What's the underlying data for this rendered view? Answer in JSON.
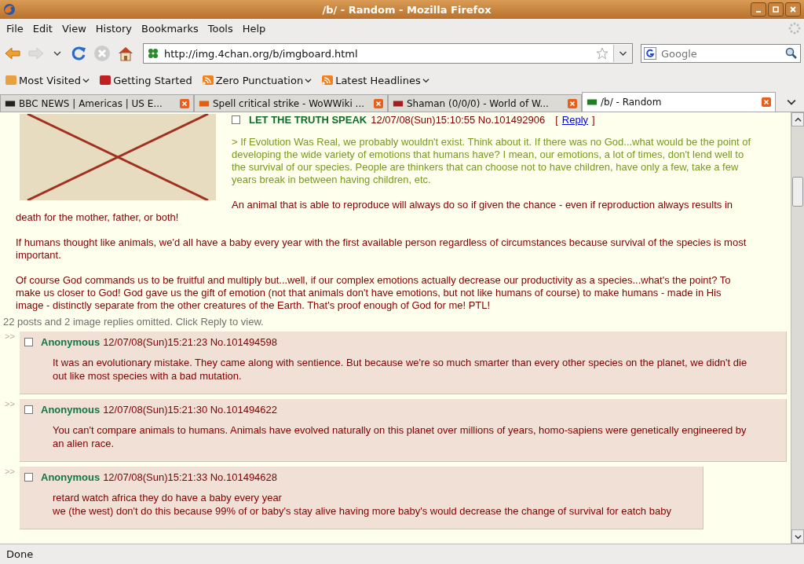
{
  "window": {
    "title": "/b/ - Random - Mozilla Firefox"
  },
  "menu": [
    "File",
    "Edit",
    "View",
    "History",
    "Bookmarks",
    "Tools",
    "Help"
  ],
  "navigation": {
    "url": "http://img.4chan.org/b/imgboard.html",
    "search_placeholder": "Google"
  },
  "bookmarks": [
    {
      "label": "Most Visited",
      "kind": "folder"
    },
    {
      "label": "Getting Started",
      "kind": "page"
    },
    {
      "label": "Zero Punctuation",
      "kind": "feed"
    },
    {
      "label": "Latest Headlines",
      "kind": "feed"
    }
  ],
  "tabs": [
    {
      "label": "BBC NEWS | Americas | US E...",
      "selected": false,
      "kind": "news"
    },
    {
      "label": "Spell critical strike - WoWWiki ...",
      "selected": false,
      "kind": "wiki"
    },
    {
      "label": "Shaman (0/0/0) - World of W...",
      "selected": false,
      "kind": "game"
    },
    {
      "label": "/b/ - Random",
      "selected": true,
      "kind": "board"
    }
  ],
  "thread": {
    "op": {
      "checked": false,
      "subject": "LET THE TRUTH SPEAK",
      "date_no": "12/07/08(Sun)15:10:55 No.101492906",
      "reply_open": "[",
      "reply_link": "Reply",
      "reply_close": "]",
      "quote": "> If Evolution Was Real, we probably wouldn't exist. Think about it. If there was no God...what would be the point of developing the wide variety of emotions that humans have? I mean, our emotions, a lot of times, don't lend well to the survival of our species. People are thinkers that can choose not to have children, have only a few, take a few years break in between having children, etc.",
      "paragraphs": [
        "An animal that is able to reproduce will always do so if given the chance - even if reproduction always results in death for the mother, father, or both!",
        "If humans thought like animals, we'd all have a baby every year with the first available person regardless of circumstances because survival of the species is most important.",
        "Of course God commands us to be fruitful and multiply but...well, if our complex emotions actually decrease our productivity as a species...what's the point? To make us closer to God! God gave us the gift of emotion (not that animals don't have emotions, but not like humans of course) to make humans - made in His image - distinctly separate from the other creatures of the Earth. That's proof enough of God for me! PTL!"
      ]
    },
    "omitted": "22 posts and 2 image replies omitted. Click Reply to view.",
    "replies": [
      {
        "marker": ">>",
        "checked": false,
        "name": "Anonymous",
        "date_no": "12/07/08(Sun)15:21:23 No.101494598",
        "lines": [
          "It was an evolutionary mistake. They came along with sentience. But because we're so much smarter than every other species on the planet, we didn't die out like most species with a bad mutation."
        ]
      },
      {
        "marker": ">>",
        "checked": false,
        "name": "Anonymous",
        "date_no": "12/07/08(Sun)15:21:30 No.101494622",
        "lines": [
          "You can't compare animals to humans. Animals have evolved naturally on this planet over millions of years, homo-sapiens were genetically engineered by an alien race."
        ]
      },
      {
        "marker": ">>",
        "checked": false,
        "name": "Anonymous",
        "date_no": "12/07/08(Sun)15:21:33 No.101494628",
        "lines": [
          "retard watch africa they do have a baby every year",
          "we (the west) don't do this because 99% of or baby's stay alive having more baby's would decrease the change of survival for eatch baby"
        ]
      }
    ]
  },
  "status_bar": "Done"
}
